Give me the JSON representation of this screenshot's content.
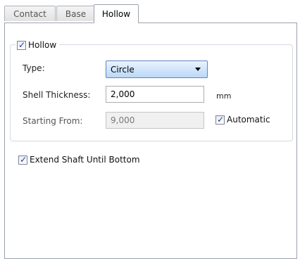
{
  "tabs": [
    {
      "label": "Contact",
      "active": false
    },
    {
      "label": "Base",
      "active": false
    },
    {
      "label": "Hollow",
      "active": true
    }
  ],
  "hollow_group": {
    "checkbox_label": "Hollow",
    "checked": true,
    "type_label": "Type:",
    "type_value": "Circle",
    "shell_thickness_label": "Shell Thickness:",
    "shell_thickness_value": "2,000",
    "shell_thickness_unit": "mm",
    "starting_from_label": "Starting From:",
    "starting_from_value": "9,000",
    "automatic_label": "Automatic",
    "automatic_checked": true
  },
  "extend_shaft": {
    "label": "Extend Shaft Until Bottom",
    "checked": true
  },
  "colors": {
    "accent": "#5a86c4",
    "check": "#2a3b8f",
    "border": "#9ca3ad"
  }
}
